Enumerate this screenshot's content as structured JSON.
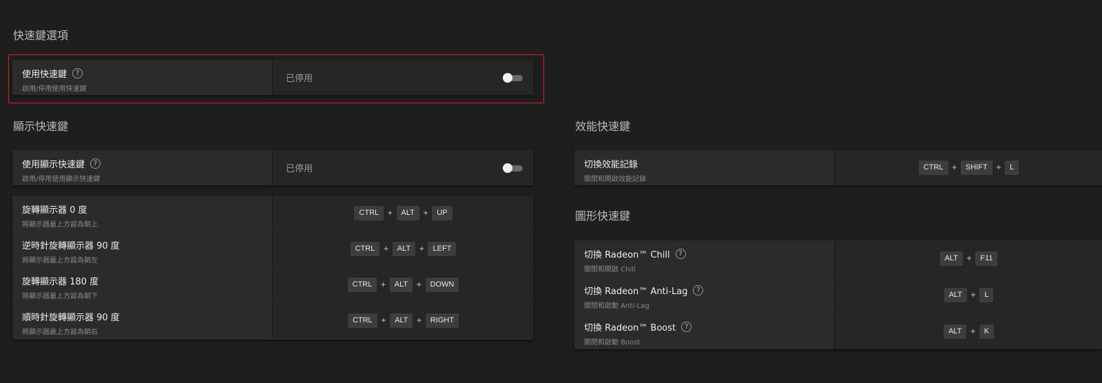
{
  "sections": {
    "hotkey_options": "快速鍵選項",
    "display_hotkeys": "顯示快速鍵",
    "performance_hotkeys": "效能快速鍵",
    "graphics_hotkeys": "圖形快速鍵"
  },
  "enable_hotkeys": {
    "title": "使用快速鍵",
    "subtitle": "啟用/停用使用快速鍵",
    "status": "已停用",
    "toggle_on": false
  },
  "display": {
    "enable": {
      "title": "使用顯示快速鍵",
      "subtitle": "啟用/停用使用顯示快速鍵",
      "status": "已停用",
      "toggle_on": false
    },
    "rows": [
      {
        "title": "旋轉顯示器 0 度",
        "subtitle": "將顯示器最上方設為朝上",
        "keys": [
          "CTRL",
          "ALT",
          "UP"
        ]
      },
      {
        "title": "逆時針旋轉顯示器 90 度",
        "subtitle": "將顯示器最上方設為朝左",
        "keys": [
          "CTRL",
          "ALT",
          "LEFT"
        ]
      },
      {
        "title": "旋轉顯示器 180 度",
        "subtitle": "將顯示器最上方設為朝下",
        "keys": [
          "CTRL",
          "ALT",
          "DOWN"
        ]
      },
      {
        "title": "順時針旋轉顯示器 90 度",
        "subtitle": "將顯示器最上方設為朝右",
        "keys": [
          "CTRL",
          "ALT",
          "RIGHT"
        ]
      }
    ]
  },
  "performance": {
    "rows": [
      {
        "title": "切換效能記錄",
        "subtitle": "關閉和開啟效能記錄",
        "keys": [
          "CTRL",
          "SHIFT",
          "L"
        ]
      }
    ]
  },
  "graphics": {
    "rows": [
      {
        "title": "切換 Radeon™ Chill",
        "subtitle": "關閉和開啟 Chill",
        "keys": [
          "ALT",
          "F11"
        ]
      },
      {
        "title": "切換 Radeon™ Anti-Lag",
        "subtitle": "關閉和啟動 Anti-Lag",
        "keys": [
          "ALT",
          "L"
        ]
      },
      {
        "title": "切換 Radeon™ Boost",
        "subtitle": "關閉和啟動 Boost",
        "keys": [
          "ALT",
          "K"
        ]
      }
    ]
  },
  "plus_symbol": "+",
  "help_symbol": "?"
}
